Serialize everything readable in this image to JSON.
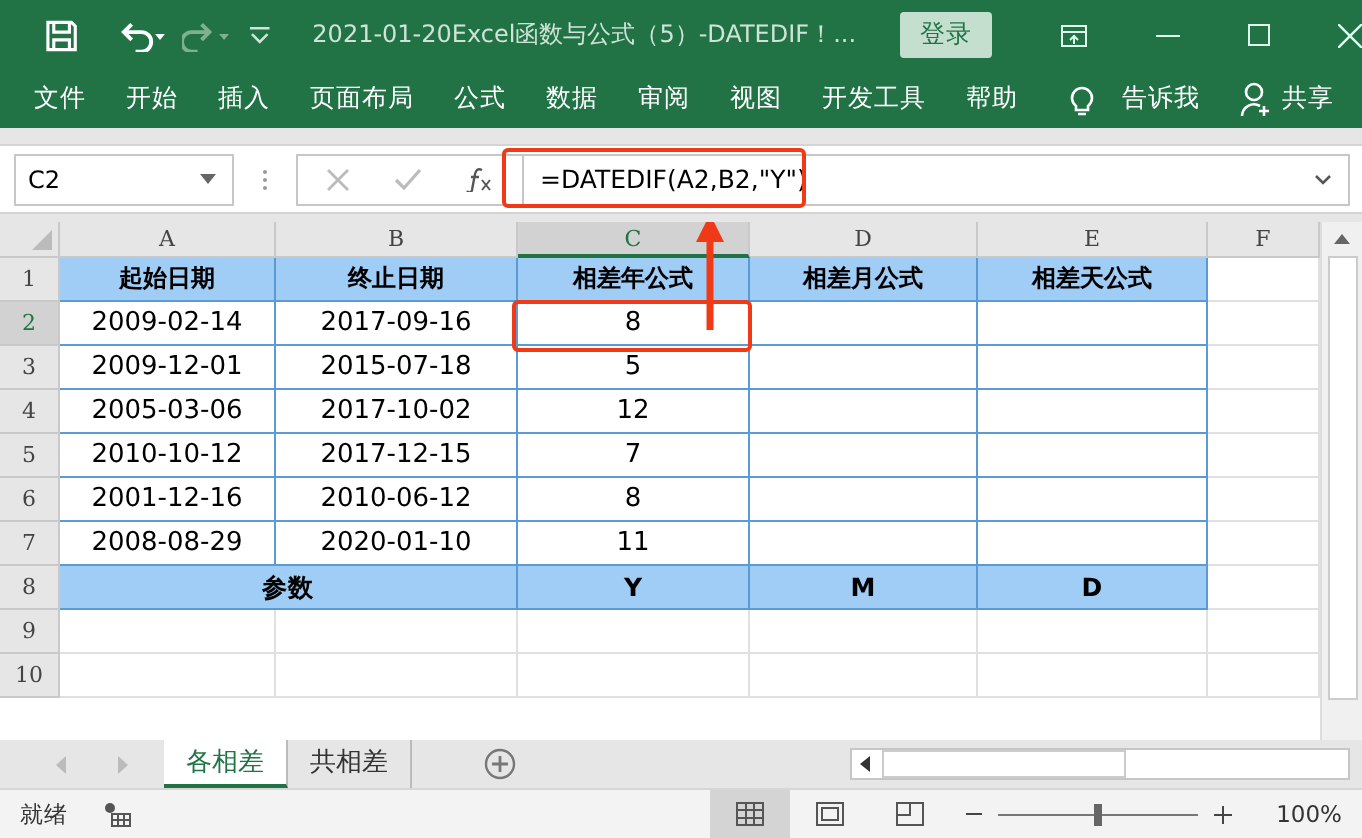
{
  "window": {
    "title": "2021-01-20Excel函数与公式（5）-DATEDIF！...",
    "login_button": "登录"
  },
  "ribbon": {
    "tabs": [
      {
        "label": "文件"
      },
      {
        "label": "开始"
      },
      {
        "label": "插入"
      },
      {
        "label": "页面布局"
      },
      {
        "label": "公式"
      },
      {
        "label": "数据"
      },
      {
        "label": "审阅"
      },
      {
        "label": "视图"
      },
      {
        "label": "开发工具"
      },
      {
        "label": "帮助"
      }
    ],
    "tell_me": "告诉我",
    "share": "共享"
  },
  "formula_bar": {
    "name_box": "C2",
    "formula": "=DATEDIF(A2,B2,\"Y\")"
  },
  "sheet": {
    "columns": [
      "A",
      "B",
      "C",
      "D",
      "E",
      "F"
    ],
    "rows": [
      {
        "num": "1",
        "kind": "header",
        "cells": [
          "起始日期",
          "终止日期",
          "相差年公式",
          "相差月公式",
          "相差天公式"
        ]
      },
      {
        "num": "2",
        "kind": "data",
        "cells": [
          "2009-02-14",
          "2017-09-16",
          "8",
          "",
          ""
        ]
      },
      {
        "num": "3",
        "kind": "data",
        "cells": [
          "2009-12-01",
          "2015-07-18",
          "5",
          "",
          ""
        ]
      },
      {
        "num": "4",
        "kind": "data",
        "cells": [
          "2005-03-06",
          "2017-10-02",
          "12",
          "",
          ""
        ]
      },
      {
        "num": "5",
        "kind": "data",
        "cells": [
          "2010-10-12",
          "2017-12-15",
          "7",
          "",
          ""
        ]
      },
      {
        "num": "6",
        "kind": "data",
        "cells": [
          "2001-12-16",
          "2010-06-12",
          "8",
          "",
          ""
        ]
      },
      {
        "num": "7",
        "kind": "data",
        "cells": [
          "2008-08-29",
          "2020-01-10",
          "11",
          "",
          ""
        ]
      },
      {
        "num": "8",
        "kind": "param",
        "cells": [
          "参数",
          "",
          "Y",
          "M",
          "D"
        ]
      },
      {
        "num": "9",
        "kind": "empty",
        "cells": []
      },
      {
        "num": "10",
        "kind": "empty",
        "cells": []
      }
    ]
  },
  "sheet_tabs": [
    {
      "label": "各相差",
      "selected": true
    },
    {
      "label": "共相差",
      "selected": false
    }
  ],
  "status_bar": {
    "status": "就绪",
    "zoom": "100%",
    "level": 0.5
  }
}
